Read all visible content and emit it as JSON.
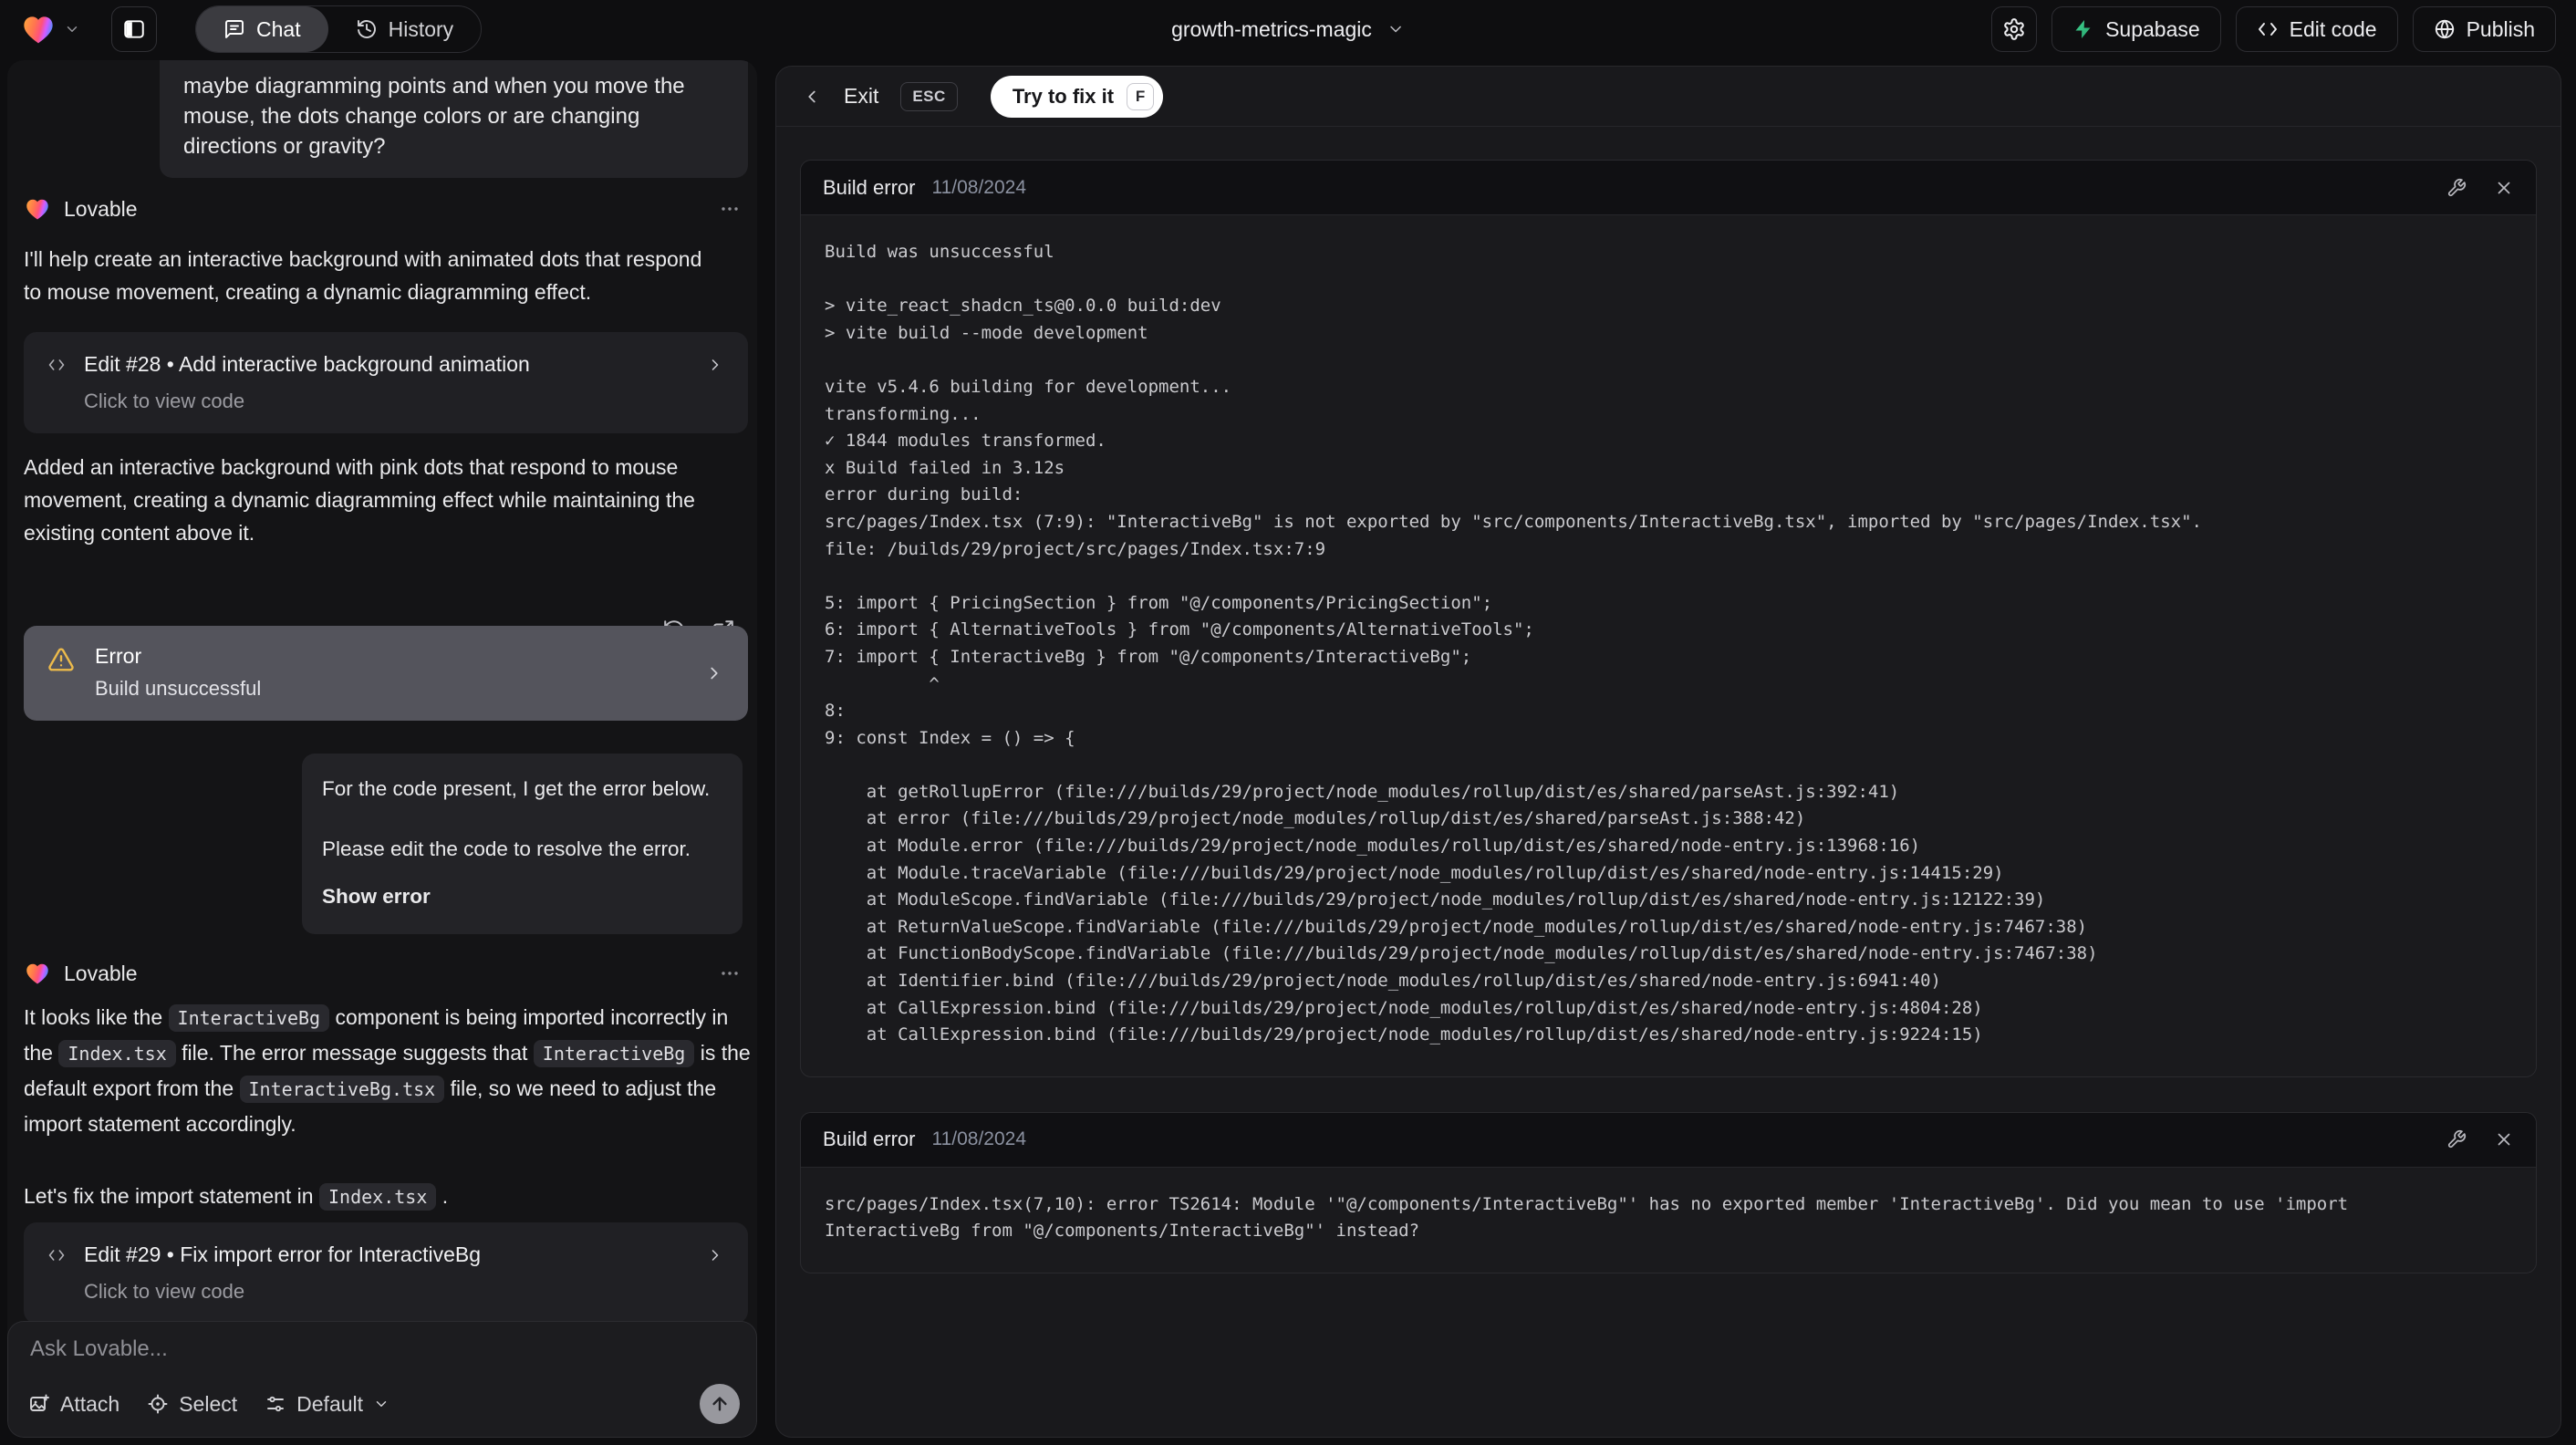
{
  "topbar": {
    "tab_chat": "Chat",
    "tab_history": "History",
    "project_name": "growth-metrics-magic",
    "supabase_label": "Supabase",
    "edit_code_label": "Edit code",
    "publish_label": "Publish"
  },
  "colors": {
    "supabase_green": "#3ecf8e",
    "warning_amber": "#ecba4b",
    "fix_button_bg": "#ffffff",
    "error_card_bg": "#54545c"
  },
  "icons": {
    "logo": "lovable-heart-icon",
    "topbar": [
      "chevron-down-icon",
      "sidebar-panel-icon",
      "chat-bubble-icon",
      "history-icon",
      "gear-icon",
      "supabase-bolt-icon",
      "code-icon",
      "globe-icon"
    ],
    "chat": [
      "ellipsis-icon",
      "refresh-icon",
      "open-in-new-icon",
      "warning-triangle-icon",
      "chevron-right-icon",
      "attach-image-icon",
      "select-crosshair-icon",
      "sliders-icon",
      "arrow-up-icon"
    ],
    "error_panel": [
      "chevron-left-icon",
      "wrench-icon",
      "close-icon"
    ]
  },
  "chat": {
    "assistant_name": "Lovable",
    "user_message_top": "maybe diagramming points and when you move the\nmouse, the dots change colors or are changing\ndirections or gravity?",
    "assistant_intro": "I'll help create an interactive background with animated dots that respond\nto mouse movement, creating a dynamic diagramming effect.",
    "edit_card_28": {
      "title": "Edit #28 • Add interactive background animation",
      "subtitle": "Click to view code"
    },
    "assistant_summary": "Added an interactive background with pink dots that respond to mouse\nmovement, creating a dynamic diagramming effect while maintaining the\nexisting content above it.",
    "error_status": {
      "title": "Error",
      "subtitle": "Build unsuccessful"
    },
    "user_error_report": {
      "line1": "For the code present, I get the error below.",
      "line2": "Please edit the code to resolve the error.",
      "action": "Show error"
    },
    "assistant_fix": {
      "segments": [
        "It looks like the ",
        "InteractiveBg",
        " component is being imported incorrectly in the ",
        "Index.tsx",
        " file. The error message suggests that ",
        "InteractiveBg",
        " is the default export from the ",
        "InteractiveBg.tsx",
        " file, so we need to adjust the import statement accordingly."
      ],
      "closing_segments": [
        "Let's fix the import statement in ",
        "Index.tsx",
        " ."
      ]
    },
    "edit_card_29": {
      "title": "Edit #29 • Fix import error for InteractiveBg",
      "subtitle": "Click to view code"
    },
    "input": {
      "placeholder": "Ask Lovable...",
      "attach_label": "Attach",
      "select_label": "Select",
      "mode_label": "Default"
    }
  },
  "error_panel": {
    "exit_label": "Exit",
    "esc_key": "ESC",
    "fix_button_label": "Try to fix it",
    "fix_key": "F",
    "cards": [
      {
        "title": "Build error",
        "date": "11/08/2024",
        "lines": [
          "Build was unsuccessful",
          "",
          "> vite_react_shadcn_ts@0.0.0 build:dev",
          "> vite build --mode development",
          "",
          "vite v5.4.6 building for development...",
          "transforming...",
          "✓ 1844 modules transformed.",
          "x Build failed in 3.12s",
          "error during build:",
          "src/pages/Index.tsx (7:9): \"InteractiveBg\" is not exported by \"src/components/InteractiveBg.tsx\", imported by \"src/pages/Index.tsx\".",
          "file: /builds/29/project/src/pages/Index.tsx:7:9",
          "",
          "5: import { PricingSection } from \"@/components/PricingSection\";",
          "6: import { AlternativeTools } from \"@/components/AlternativeTools\";",
          "7: import { InteractiveBg } from \"@/components/InteractiveBg\";",
          "          ^",
          "8:",
          "9: const Index = () => {",
          "",
          "    at getRollupError (file:///builds/29/project/node_modules/rollup/dist/es/shared/parseAst.js:392:41)",
          "    at error (file:///builds/29/project/node_modules/rollup/dist/es/shared/parseAst.js:388:42)",
          "    at Module.error (file:///builds/29/project/node_modules/rollup/dist/es/shared/node-entry.js:13968:16)",
          "    at Module.traceVariable (file:///builds/29/project/node_modules/rollup/dist/es/shared/node-entry.js:14415:29)",
          "    at ModuleScope.findVariable (file:///builds/29/project/node_modules/rollup/dist/es/shared/node-entry.js:12122:39)",
          "    at ReturnValueScope.findVariable (file:///builds/29/project/node_modules/rollup/dist/es/shared/node-entry.js:7467:38)",
          "    at FunctionBodyScope.findVariable (file:///builds/29/project/node_modules/rollup/dist/es/shared/node-entry.js:7467:38)",
          "    at Identifier.bind (file:///builds/29/project/node_modules/rollup/dist/es/shared/node-entry.js:6941:40)",
          "    at CallExpression.bind (file:///builds/29/project/node_modules/rollup/dist/es/shared/node-entry.js:4804:28)",
          "    at CallExpression.bind (file:///builds/29/project/node_modules/rollup/dist/es/shared/node-entry.js:9224:15)"
        ]
      },
      {
        "title": "Build error",
        "date": "11/08/2024",
        "lines": [
          "src/pages/Index.tsx(7,10): error TS2614: Module '\"@/components/InteractiveBg\"' has no exported member 'InteractiveBg'. Did you mean to use 'import",
          "InteractiveBg from \"@/components/InteractiveBg\"' instead?"
        ]
      }
    ]
  }
}
